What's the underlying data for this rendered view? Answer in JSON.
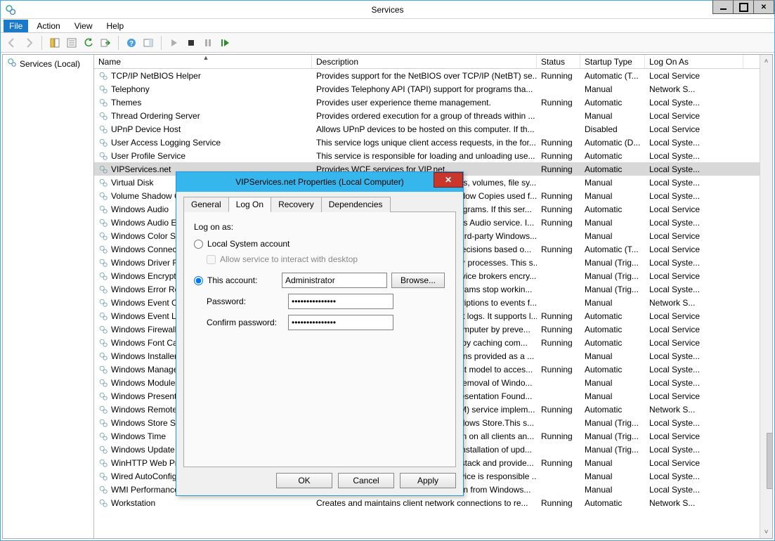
{
  "window": {
    "title": "Services"
  },
  "menubar": [
    "File",
    "Action",
    "View",
    "Help"
  ],
  "tree": {
    "root_label": "Services (Local)"
  },
  "columns": {
    "name": "Name",
    "description": "Description",
    "status": "Status",
    "startup": "Startup Type",
    "logon": "Log On As"
  },
  "services": [
    {
      "name": "TCP/IP NetBIOS Helper",
      "desc": "Provides support for the NetBIOS over TCP/IP (NetBT) se...",
      "status": "Running",
      "startup": "Automatic (T...",
      "logon": "Local Service"
    },
    {
      "name": "Telephony",
      "desc": "Provides Telephony API (TAPI) support for programs tha...",
      "status": "",
      "startup": "Manual",
      "logon": "Network S..."
    },
    {
      "name": "Themes",
      "desc": "Provides user experience theme management.",
      "status": "Running",
      "startup": "Automatic",
      "logon": "Local Syste..."
    },
    {
      "name": "Thread Ordering Server",
      "desc": "Provides ordered execution for a group of threads within ...",
      "status": "",
      "startup": "Manual",
      "logon": "Local Service"
    },
    {
      "name": "UPnP Device Host",
      "desc": "Allows UPnP devices to be hosted on this computer. If th...",
      "status": "",
      "startup": "Disabled",
      "logon": "Local Service"
    },
    {
      "name": "User Access Logging Service",
      "desc": "This service logs unique client access requests, in the for...",
      "status": "Running",
      "startup": "Automatic (D...",
      "logon": "Local Syste..."
    },
    {
      "name": "User Profile Service",
      "desc": "This service is responsible for loading and unloading use...",
      "status": "Running",
      "startup": "Automatic",
      "logon": "Local Syste..."
    },
    {
      "name": "VIPServices.net",
      "desc": "Provides WCF services for VIP.net.",
      "status": "Running",
      "startup": "Automatic",
      "logon": "Local Syste...",
      "selected": true
    },
    {
      "name": "Virtual Disk",
      "desc": "Provides management services for disks, volumes, file sy...",
      "status": "",
      "startup": "Manual",
      "logon": "Local Syste..."
    },
    {
      "name": "Volume Shadow Copy",
      "desc": "Manages and implements Volume Shadow Copies used f...",
      "status": "Running",
      "startup": "Manual",
      "logon": "Local Syste..."
    },
    {
      "name": "Windows Audio",
      "desc": "Manages audio for Windows-based programs.  If this ser...",
      "status": "Running",
      "startup": "Automatic",
      "logon": "Local Service"
    },
    {
      "name": "Windows Audio Endpoint Builder",
      "desc": "Manages audio devices for the Windows Audio service.  I...",
      "status": "Running",
      "startup": "Manual",
      "logon": "Local Syste..."
    },
    {
      "name": "Windows Color System",
      "desc": "The WcsPlugInService service hosts third-party Windows...",
      "status": "",
      "startup": "Manual",
      "logon": "Local Service"
    },
    {
      "name": "Windows Connection Manager",
      "desc": "Makes automatic connect/disconnect decisions based o...",
      "status": "Running",
      "startup": "Automatic (T...",
      "logon": "Local Service"
    },
    {
      "name": "Windows Driver Foundation",
      "desc": "Creates and manages user-mode driver processes. This s...",
      "status": "",
      "startup": "Manual (Trig...",
      "logon": "Local Syste..."
    },
    {
      "name": "Windows Encryption Provider",
      "desc": "Windows Encryption Provider Host Service brokers encry...",
      "status": "",
      "startup": "Manual (Trig...",
      "logon": "Local Service"
    },
    {
      "name": "Windows Error Reporting",
      "desc": "Allows errors to be reported when programs stop workin...",
      "status": "",
      "startup": "Manual (Trig...",
      "logon": "Local Syste..."
    },
    {
      "name": "Windows Event Collector",
      "desc": "This service manages persistent subscriptions to events f...",
      "status": "",
      "startup": "Manual",
      "logon": "Network S..."
    },
    {
      "name": "Windows Event Log",
      "desc": "This service manages events and event logs. It supports l...",
      "status": "Running",
      "startup": "Automatic",
      "logon": "Local Service"
    },
    {
      "name": "Windows Firewall",
      "desc": "Windows Firewall helps protect your computer by preve...",
      "status": "Running",
      "startup": "Automatic",
      "logon": "Local Service"
    },
    {
      "name": "Windows Font Cache Service",
      "desc": "Optimizes performance of applications by caching com...",
      "status": "Running",
      "startup": "Automatic",
      "logon": "Local Service"
    },
    {
      "name": "Windows Installer",
      "desc": "Adds, modifies, and removes applications provided as a ...",
      "status": "",
      "startup": "Manual",
      "logon": "Local Syste..."
    },
    {
      "name": "Windows Management Instrumentation",
      "desc": "Provides a common interface and object model to acces...",
      "status": "Running",
      "startup": "Automatic",
      "logon": "Local Syste..."
    },
    {
      "name": "Windows Modules Installer",
      "desc": "Enables installation, modification, and removal of Windo...",
      "status": "",
      "startup": "Manual",
      "logon": "Local Syste..."
    },
    {
      "name": "Windows Presentation Foundation",
      "desc": "Optimizes performance of Windows Presentation Found...",
      "status": "",
      "startup": "Manual",
      "logon": "Local Service"
    },
    {
      "name": "Windows Remote Management",
      "desc": "Windows Remote Management (WinRM) service implem...",
      "status": "Running",
      "startup": "Automatic",
      "logon": "Network S..."
    },
    {
      "name": "Windows Store Service",
      "desc": "Provides infrastructure support for Windows Store.This s...",
      "status": "",
      "startup": "Manual (Trig...",
      "logon": "Local Syste..."
    },
    {
      "name": "Windows Time",
      "desc": "Maintains date and time synchronization on all clients an...",
      "status": "Running",
      "startup": "Manual (Trig...",
      "logon": "Local Service"
    },
    {
      "name": "Windows Update",
      "desc": "Enables the detection, download, and installation of upd...",
      "status": "",
      "startup": "Manual (Trig...",
      "logon": "Local Syste..."
    },
    {
      "name": "WinHTTP Web Proxy",
      "desc": "WinHTTP implements the client HTTP stack and provide...",
      "status": "Running",
      "startup": "Manual",
      "logon": "Local Service"
    },
    {
      "name": "Wired AutoConfig",
      "desc": "The Wired AutoConfig (DOT3SVC) service is responsible ...",
      "status": "",
      "startup": "Manual",
      "logon": "Local Syste..."
    },
    {
      "name": "WMI Performance Adapter",
      "desc": "Provides performance library information from Windows...",
      "status": "",
      "startup": "Manual",
      "logon": "Local Syste..."
    },
    {
      "name": "Workstation",
      "desc": "Creates and maintains client network connections to re...",
      "status": "Running",
      "startup": "Automatic",
      "logon": "Network S..."
    }
  ],
  "dialog": {
    "title": "VIPServices.net Properties (Local Computer)",
    "tabs": [
      "General",
      "Log On",
      "Recovery",
      "Dependencies"
    ],
    "active_tab": "Log On",
    "logon": {
      "heading": "Log on as:",
      "opt_local_system": "Local System account",
      "allow_interact": "Allow service to interact with desktop",
      "opt_this_account": "This account:",
      "account_value": "Administrator",
      "browse": "Browse...",
      "password_label": "Password:",
      "password_value": "•••••••••••••••",
      "confirm_label": "Confirm password:",
      "confirm_value": "•••••••••••••••"
    },
    "buttons": {
      "ok": "OK",
      "cancel": "Cancel",
      "apply": "Apply"
    }
  }
}
